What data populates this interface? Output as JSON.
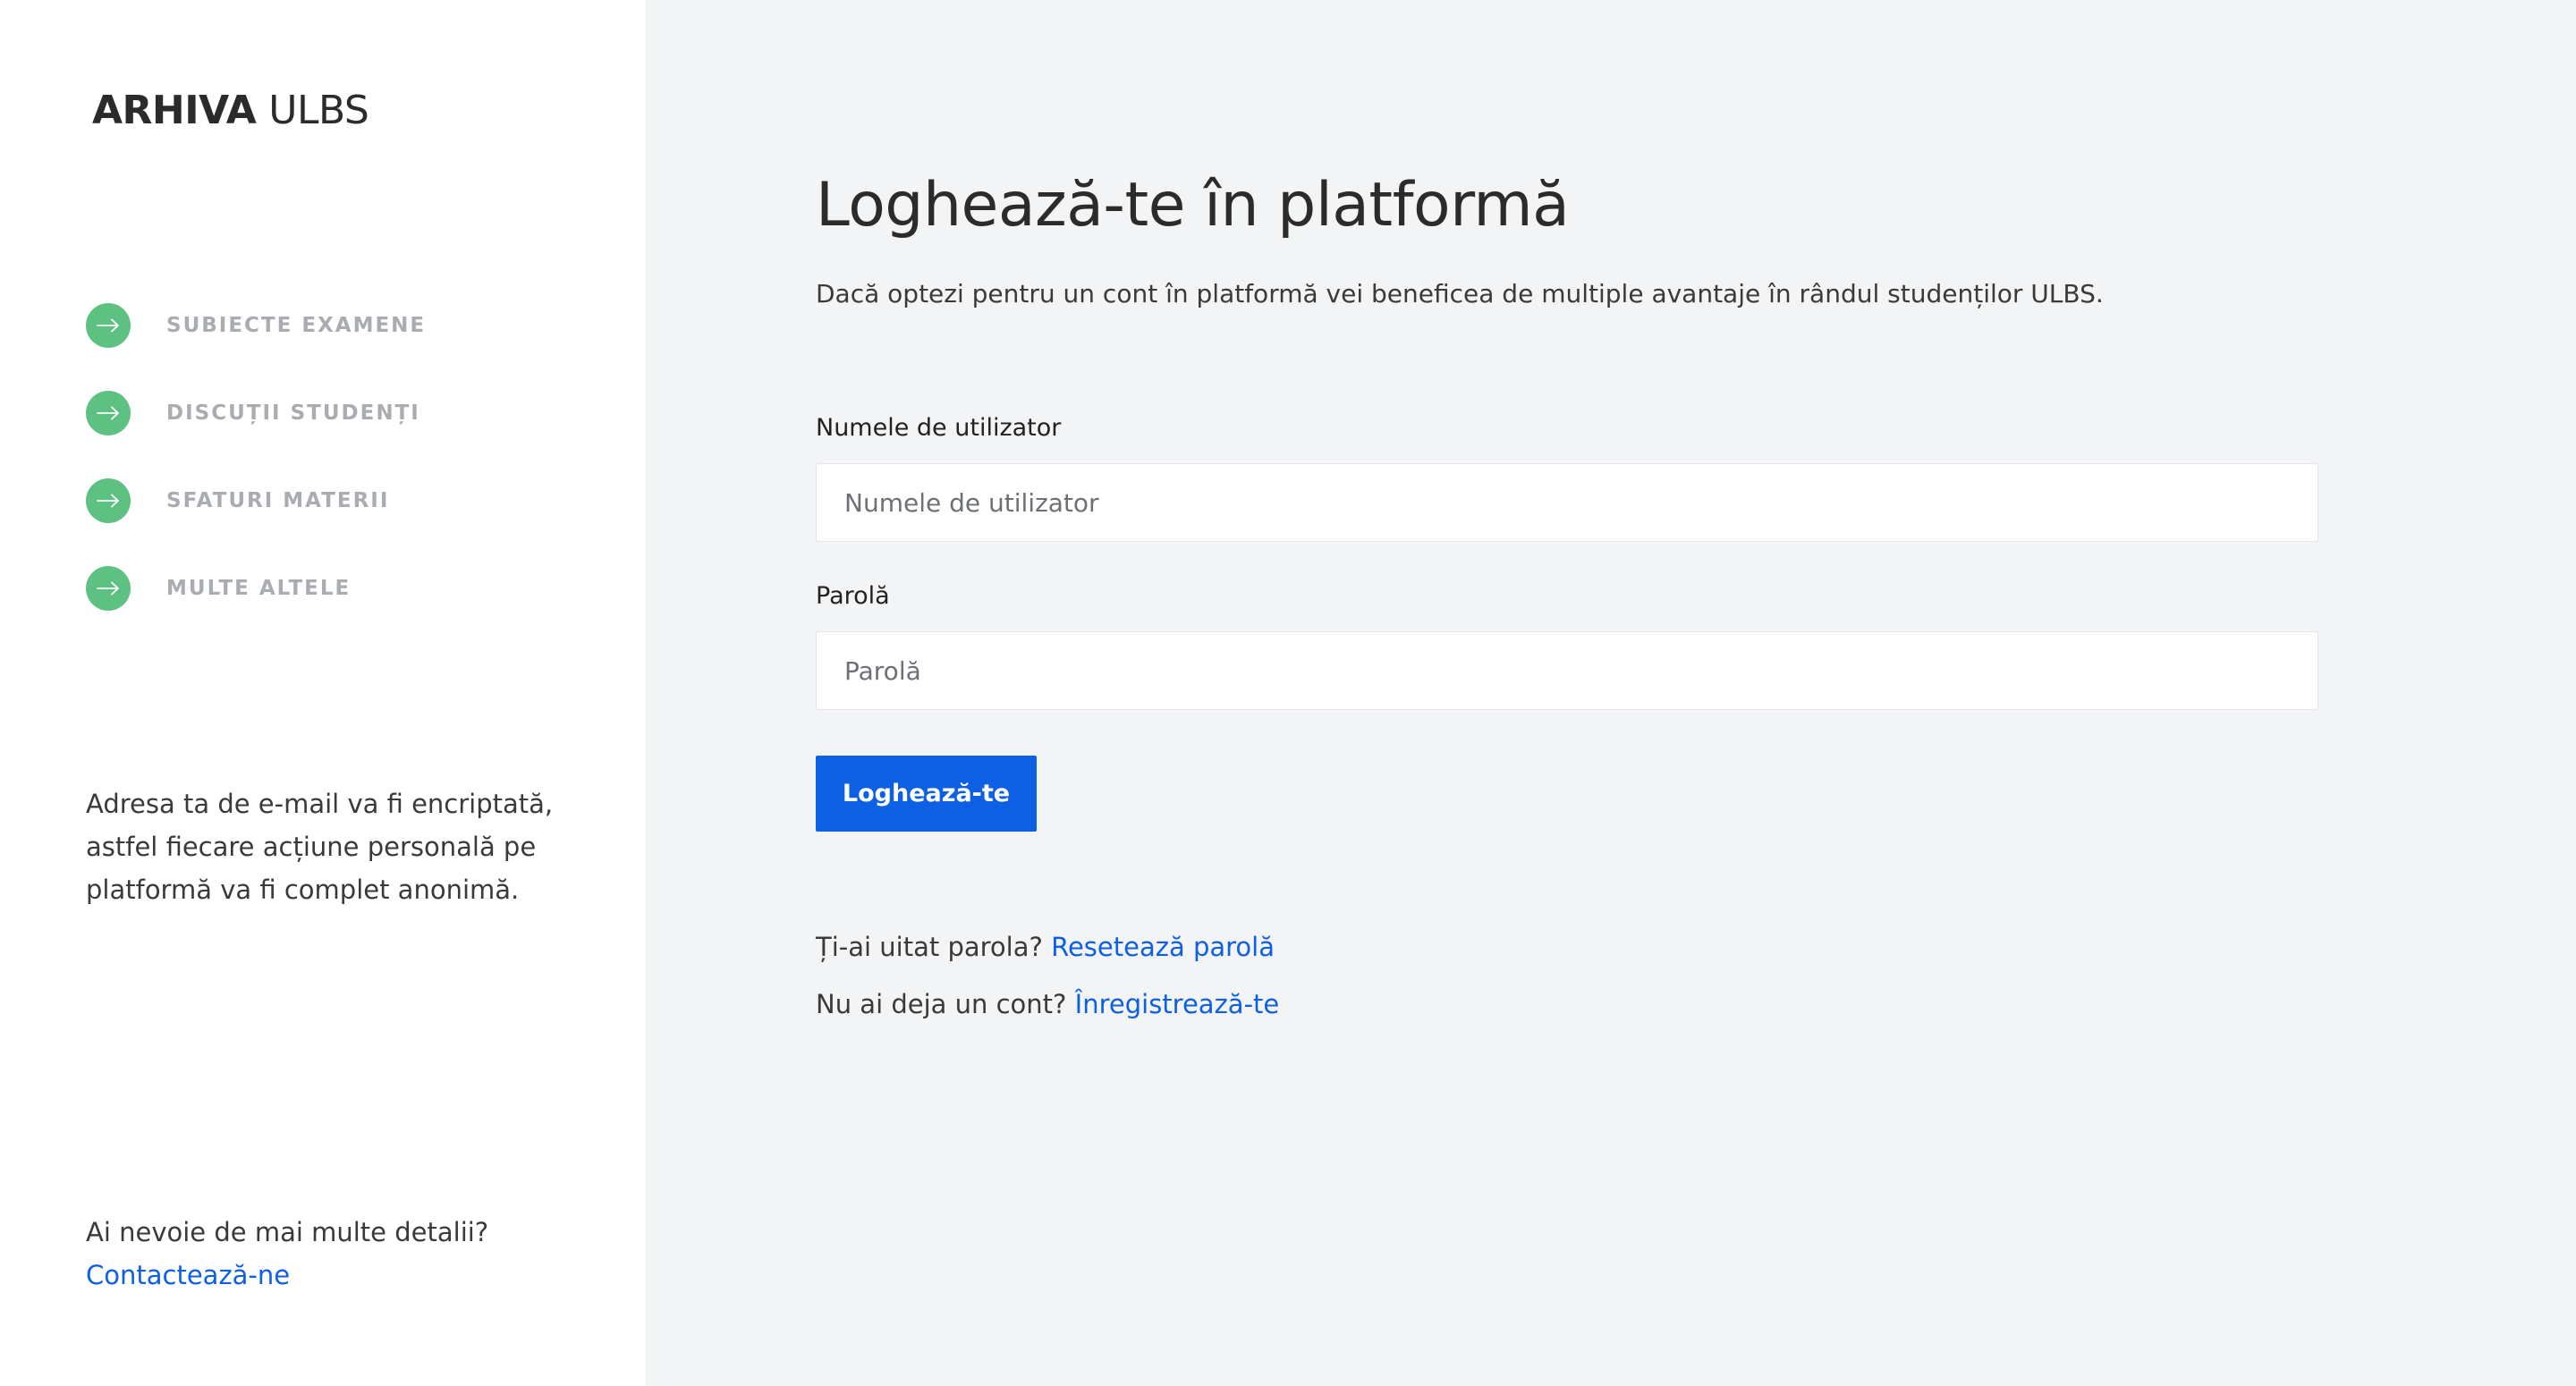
{
  "brand": {
    "bold": "ARHIVA",
    "light": "ULBS"
  },
  "features": [
    {
      "label": "SUBIECTE EXAMENE",
      "icon": "arrow-right-icon"
    },
    {
      "label": "DISCUȚII STUDENȚI",
      "icon": "arrow-right-icon"
    },
    {
      "label": "SFATURI MATERII",
      "icon": "arrow-right-icon"
    },
    {
      "label": "MULTE ALTELE",
      "icon": "arrow-right-icon"
    }
  ],
  "privacy_text": "Adresa ta de e-mail va fi encriptată, astfel fiecare acțiune personală pe platformă va fi complet anonimă.",
  "contact": {
    "question": "Ai nevoie de mai multe detalii?",
    "link": "Contactează-ne"
  },
  "login": {
    "title": "Loghează-te în platformă",
    "subtitle": "Dacă optezi pentru un cont în platformă vei beneficea de multiple avantaje în rândul studenților ULBS.",
    "username_label": "Numele de utilizator",
    "username_placeholder": "Numele de utilizator",
    "password_label": "Parolă",
    "password_placeholder": "Parolă",
    "submit_label": "Loghează-te",
    "forgot_text": "Ți-ai uitat parola?",
    "forgot_link": "Resetează parolă",
    "register_text": "Nu ai deja un cont?",
    "register_link": "Înregistrează-te"
  },
  "colors": {
    "accent": "#0d5fe3",
    "feature_icon": "#5cc181",
    "sidebar_bg": "#ffffff",
    "main_bg": "#f3f4f6"
  }
}
